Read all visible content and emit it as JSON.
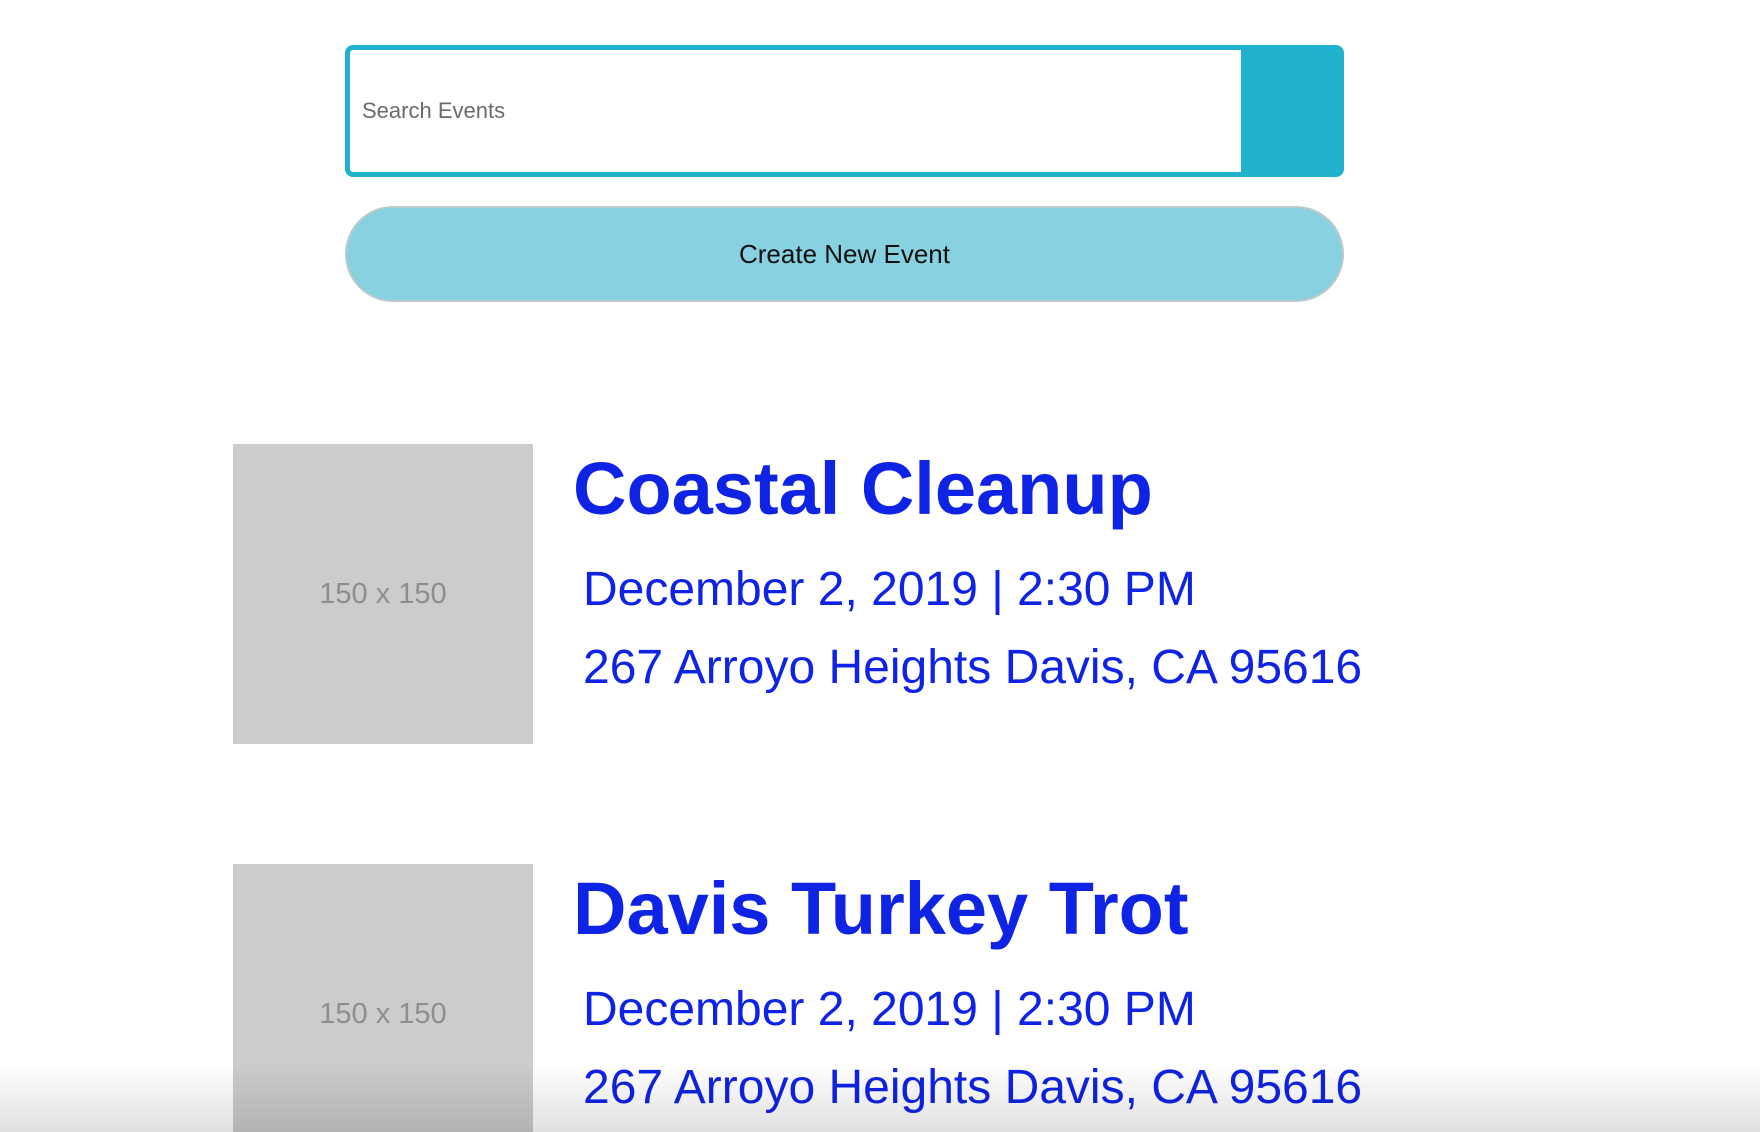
{
  "search": {
    "placeholder": "Search Events",
    "value": "",
    "accent_color": "#20b2cc"
  },
  "actions": {
    "create_event_label": "Create New Event",
    "create_event_color": "#88d1e0"
  },
  "events": [
    {
      "thumbnail_text": "150 x 150",
      "title": "Coastal Cleanup",
      "datetime": "December 2, 2019 | 2:30 PM",
      "address": "267 Arroyo Heights Davis, CA 95616"
    },
    {
      "thumbnail_text": "150 x 150",
      "title": "Davis Turkey Trot",
      "datetime": "December 2, 2019 | 2:30 PM",
      "address": "267 Arroyo Heights Davis, CA 95616"
    }
  ],
  "colors": {
    "event_text": "#0f23e5",
    "thumbnail_bg": "#cccccc"
  }
}
